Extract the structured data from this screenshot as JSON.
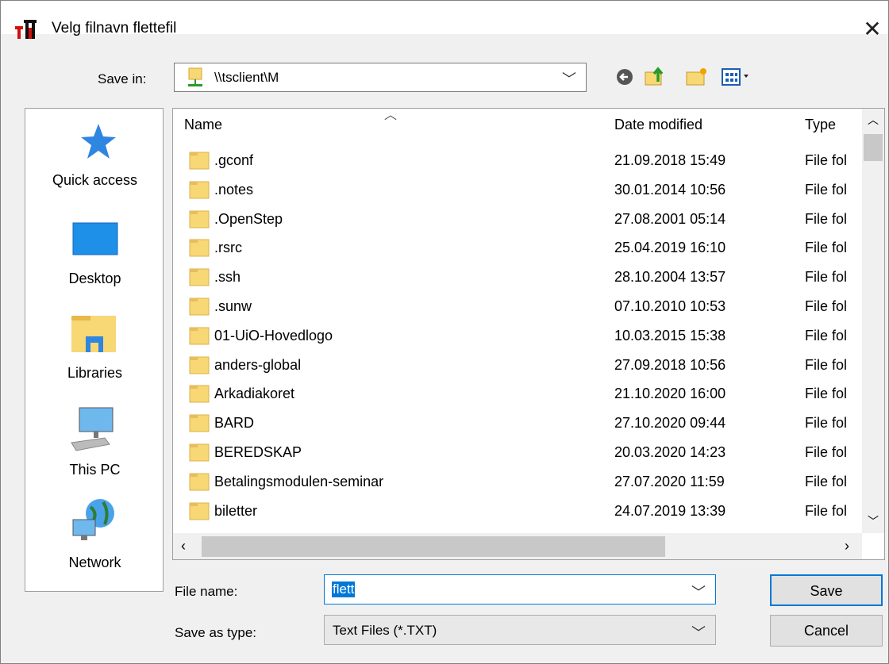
{
  "window": {
    "title": "Velg filnavn flettefil",
    "close_glyph": "✕"
  },
  "toolbar": {
    "save_in_label": "Save in:",
    "location": "\\\\tsclient\\M",
    "icons": [
      "back-icon",
      "up-folder-icon",
      "new-folder-icon",
      "view-menu-icon"
    ]
  },
  "places": [
    {
      "label": "Quick access",
      "icon": "quick-access-star-icon"
    },
    {
      "label": "Desktop",
      "icon": "desktop-icon"
    },
    {
      "label": "Libraries",
      "icon": "libraries-icon"
    },
    {
      "label": "This PC",
      "icon": "this-pc-icon"
    },
    {
      "label": "Network",
      "icon": "network-icon"
    }
  ],
  "columns": {
    "name": "Name",
    "date": "Date modified",
    "type": "Type"
  },
  "files": [
    {
      "name": ".gconf",
      "date": "21.09.2018 15:49",
      "type": "File fol"
    },
    {
      "name": ".notes",
      "date": "30.01.2014 10:56",
      "type": "File fol"
    },
    {
      "name": ".OpenStep",
      "date": "27.08.2001 05:14",
      "type": "File fol"
    },
    {
      "name": ".rsrc",
      "date": "25.04.2019 16:10",
      "type": "File fol"
    },
    {
      "name": ".ssh",
      "date": "28.10.2004 13:57",
      "type": "File fol"
    },
    {
      "name": ".sunw",
      "date": "07.10.2010 10:53",
      "type": "File fol"
    },
    {
      "name": "01-UiO-Hovedlogo",
      "date": "10.03.2015 15:38",
      "type": "File fol"
    },
    {
      "name": "anders-global",
      "date": "27.09.2018 10:56",
      "type": "File fol"
    },
    {
      "name": "Arkadiakoret",
      "date": "21.10.2020 16:00",
      "type": "File fol"
    },
    {
      "name": "BARD",
      "date": "27.10.2020 09:44",
      "type": "File fol"
    },
    {
      "name": "BEREDSKAP",
      "date": "20.03.2020 14:23",
      "type": "File fol"
    },
    {
      "name": "Betalingsmodulen-seminar",
      "date": "27.07.2020 11:59",
      "type": "File fol"
    },
    {
      "name": "biletter",
      "date": "24.07.2019 13:39",
      "type": "File fol"
    }
  ],
  "file_name": {
    "label": "File name:",
    "value": "flett"
  },
  "save_as_type": {
    "label": "Save as type:",
    "value": "Text Files (*.TXT)"
  },
  "buttons": {
    "save": "Save",
    "cancel": "Cancel"
  },
  "colors": {
    "accent": "#0078d7",
    "folder": "#f8d775"
  }
}
